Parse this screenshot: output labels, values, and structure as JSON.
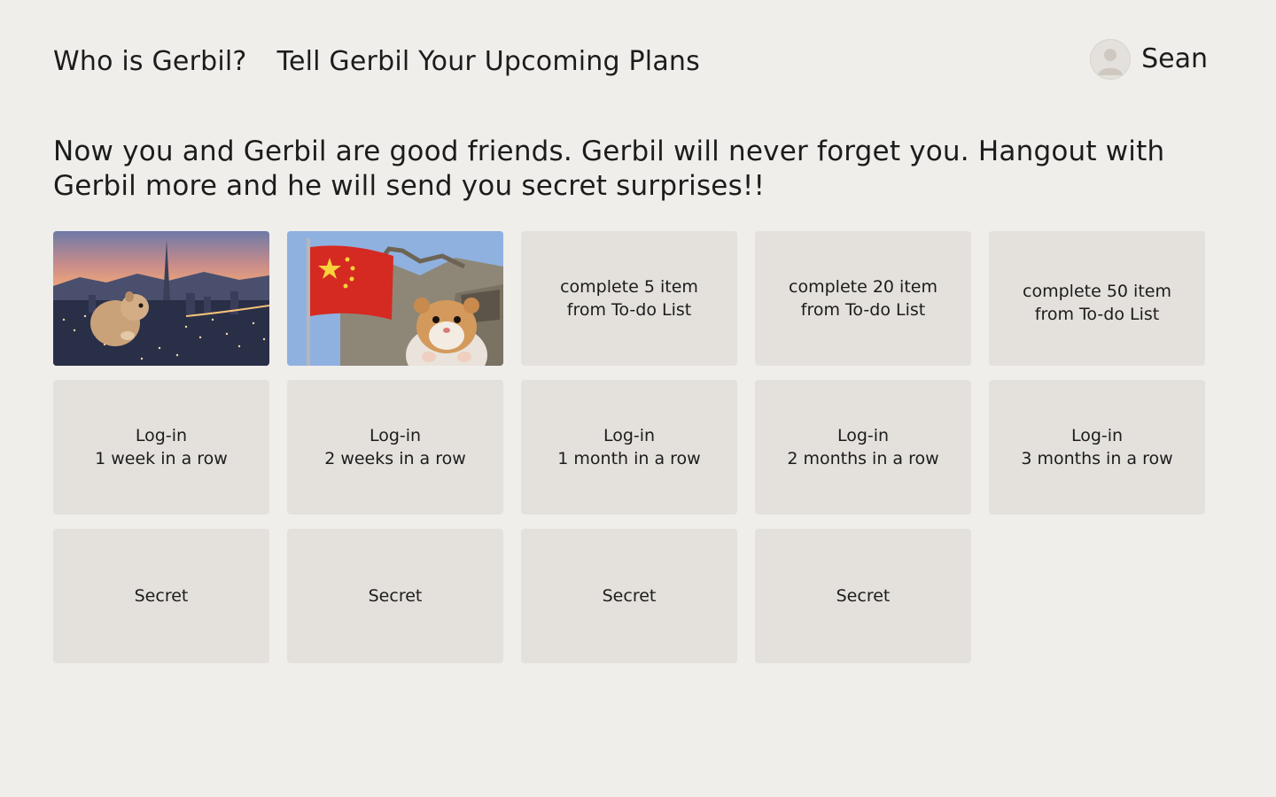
{
  "nav": {
    "links": [
      {
        "label": "Who is Gerbil?"
      },
      {
        "label": "Tell Gerbil Your Upcoming Plans"
      }
    ]
  },
  "user": {
    "name": "Sean",
    "avatar_icon": "default-user-icon"
  },
  "intro": {
    "text": "Now you and Gerbil are good friends. Gerbil will never forget you. Hangout with Gerbil more and he will send you secret surprises!!"
  },
  "rewards": [
    {
      "type": "photo",
      "name": "reward-photo-seoul"
    },
    {
      "type": "photo",
      "name": "reward-photo-great-wall"
    },
    {
      "type": "locked",
      "line1": "complete 5 item",
      "line2": "from To-do List"
    },
    {
      "type": "locked",
      "line1": "complete 20 item",
      "line2": "from To-do List"
    },
    {
      "type": "locked",
      "line1": "complete 50 item",
      "line2": "from To-do List"
    },
    {
      "type": "locked",
      "line1": "Log-in",
      "line2": "1 week in a row"
    },
    {
      "type": "locked",
      "line1": "Log-in",
      "line2": "2 weeks in a row"
    },
    {
      "type": "locked",
      "line1": "Log-in",
      "line2": "1 month in a row"
    },
    {
      "type": "locked",
      "line1": "Log-in",
      "line2": "2 months in a row"
    },
    {
      "type": "locked",
      "line1": "Log-in",
      "line2": "3 months in a row"
    },
    {
      "type": "secret",
      "line1": "Secret"
    },
    {
      "type": "secret",
      "line1": "Secret"
    },
    {
      "type": "secret",
      "line1": "Secret"
    },
    {
      "type": "secret",
      "line1": "Secret"
    }
  ],
  "colors": {
    "background": "#efeeeb",
    "card": "#e4e1dd",
    "text": "#1c1c1c"
  }
}
